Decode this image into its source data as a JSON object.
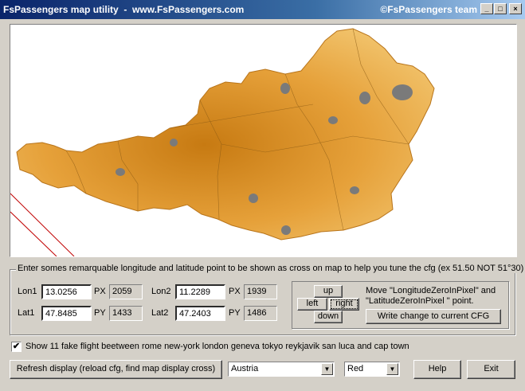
{
  "window": {
    "title": "FsPassengers map utility  -  www.FsPassengers.com",
    "team": "©FsPassengers team",
    "minimize": "_",
    "maximize": "□",
    "close": "×"
  },
  "instructions": "Enter somes remarquable longitude and latitude point to be shown as cross on map to help you tune the cfg  (ex 51.50  NOT 51°30)",
  "points": {
    "lon1_label": "Lon1",
    "lon1_value": "13.0256",
    "px1_label": "PX",
    "px1_value": "2059",
    "lat1_label": "Lat1",
    "lat1_value": "47.8485",
    "py1_label": "PY",
    "py1_value": "1433",
    "lon2_label": "Lon2",
    "lon2_value": "11.2289",
    "px2_label": "PX",
    "px2_value": "1939",
    "lat2_label": "Lat2",
    "lat2_value": "47.2403",
    "py2_label": "PY",
    "py2_value": "1486"
  },
  "move": {
    "up": "up",
    "left": "left",
    "right": "right",
    "down": "down",
    "description": "Move \"LongitudeZeroInPixel\" and \"LatitudeZeroInPixel \" point.",
    "write": "Write change to current CFG"
  },
  "fake_flight": {
    "checked": true,
    "check_mark": "✔",
    "label": "Show 11 fake flight beetween rome new-york london geneva tokyo reykjavik san luca and cap town"
  },
  "bottom": {
    "refresh": "Refresh display (reload cfg, find map display cross)",
    "map_select": "Austria",
    "color_select": "Red",
    "dropdown_arrow": "▼",
    "help": "Help",
    "exit": "Exit"
  },
  "colors": {
    "map_fill": "#e8a53a",
    "lake": "#7a7a7a",
    "cross_line": "#c00000"
  }
}
